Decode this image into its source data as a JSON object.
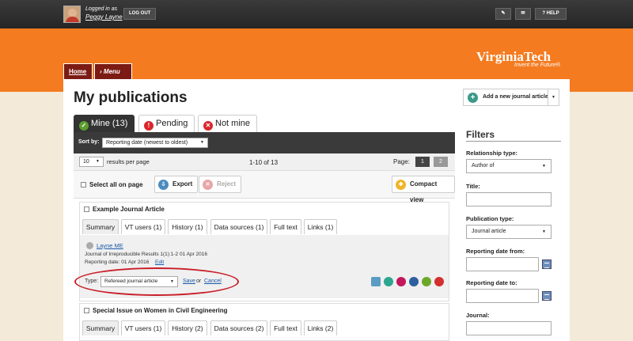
{
  "header": {
    "logged_in_as": "Logged in as",
    "user_name": "Peggy Layne",
    "logout_label": "LOG OUT",
    "help_label": "HELP"
  },
  "brand": {
    "logo_text": "VirginiaTech",
    "tagline": "Invent the Future®",
    "accent": "#f47b20",
    "maroon": "#7b1b14"
  },
  "breadcrumb": {
    "home": "Home",
    "current": "Menu"
  },
  "page": {
    "title": "My publications",
    "add_button": "Add a new journal article"
  },
  "tabs": [
    {
      "label": "Mine (13)",
      "icon": "check-icon",
      "color": "#5b9e2e"
    },
    {
      "label": "Pending",
      "icon": "exclamation-icon",
      "color": "#d9262b"
    },
    {
      "label": "Not mine",
      "icon": "x-icon",
      "color": "#d9262b"
    }
  ],
  "sort": {
    "label": "Sort by:",
    "value": "Reporting date (newest to oldest)"
  },
  "paging": {
    "per_page": "10",
    "per_page_label": "results per page",
    "range": "1-10 of 13",
    "page_label": "Page:",
    "pages": [
      "1",
      "2"
    ],
    "current_page": "1"
  },
  "actions": {
    "select_all": "Select all on page",
    "export": "Export",
    "reject": "Reject",
    "compact_view": "Compact view"
  },
  "publications": [
    {
      "title": "Example Journal Article",
      "tabs": [
        "Summary",
        "VT users (1)",
        "History (1)",
        "Data sources (1)",
        "Full text",
        "Links (1)"
      ],
      "author": "Layne ME",
      "journal_line": "Journal of Irreproducible Results 1(1):1-2 01 Apr 2016",
      "reporting_date": "Reporting date: 01 Apr 2016",
      "edit_label": "Edit",
      "type_label": "Type:",
      "type_value": "Refereed journal article",
      "save_label": "Save",
      "or_label": "or",
      "cancel_label": "Cancel"
    },
    {
      "title": "Special Issue on Women in Civil Engineering",
      "tabs": [
        "Summary",
        "VT users (1)",
        "History (2)",
        "Data sources (2)",
        "Full text",
        "Links (2)"
      ]
    }
  ],
  "filters": {
    "title": "Filters",
    "relationship_label": "Relationship type:",
    "relationship_value": "Author of",
    "title_label": "Title:",
    "pubtype_label": "Publication type:",
    "pubtype_value": "Journal article",
    "from_label": "Reporting date from:",
    "to_label": "Reporting date to:",
    "journal_label": "Journal:"
  }
}
